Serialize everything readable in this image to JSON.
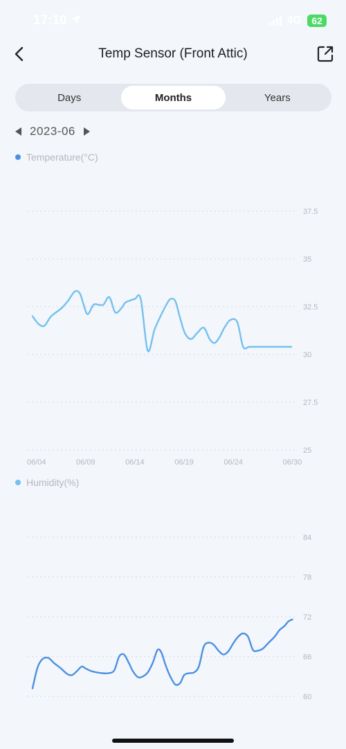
{
  "status_bar": {
    "time": "17:10",
    "network": "4G",
    "battery": "62"
  },
  "header": {
    "title": "Temp Sensor (Front Attic)"
  },
  "tabs": [
    {
      "label": "Days",
      "active": false
    },
    {
      "label": "Months",
      "active": true
    },
    {
      "label": "Years",
      "active": false
    }
  ],
  "date_nav": {
    "period": "2023-06"
  },
  "icons": {
    "back": "chevron-left-icon",
    "share": "share-external-icon",
    "prev": "triangle-left-icon",
    "next": "triangle-right-icon"
  },
  "colors": {
    "temperature": "#74c0ee",
    "humidity": "#4a90e2",
    "temp_legend_dot": "#4a90e2",
    "humidity_legend_dot": "#74c0ee"
  },
  "chart_data": [
    {
      "type": "line",
      "legend": "Temperature(°C)",
      "x_tick_labels": [
        "06/04",
        "06/09",
        "06/14",
        "06/19",
        "06/24",
        "06/30"
      ],
      "x_ticks_day": [
        4,
        9,
        14,
        19,
        24,
        30
      ],
      "ylim": [
        25,
        37.5
      ],
      "yticks": [
        25,
        27.5,
        30,
        32.5,
        35,
        37.5
      ],
      "ytick_labels": [
        "25",
        "27.5",
        "30",
        "32.5",
        "35",
        "37.5"
      ],
      "grid": true,
      "x": [
        3.6,
        4.2,
        4.8,
        5.5,
        6.5,
        7.2,
        7.9,
        8.4,
        8.8,
        9.2,
        9.8,
        10.3,
        10.8,
        11.4,
        12.0,
        12.6,
        13.0,
        13.4,
        14.0,
        14.6,
        15.3,
        16.0,
        16.7,
        17.2,
        17.6,
        18.1,
        18.6,
        19.1,
        19.7,
        20.3,
        21.0,
        21.6,
        22.1,
        22.6,
        23.1,
        23.7,
        24.4,
        25.0,
        25.6,
        26.1,
        26.6,
        27.0,
        27.5,
        28.0,
        28.6,
        29.1,
        29.6,
        29.9
      ],
      "values": [
        32.0,
        31.6,
        31.5,
        32.0,
        32.4,
        32.8,
        33.3,
        33.2,
        32.6,
        32.1,
        32.6,
        32.6,
        32.6,
        33.0,
        32.2,
        32.4,
        32.7,
        32.8,
        32.9,
        32.9,
        30.2,
        31.3,
        32.1,
        32.6,
        32.9,
        32.8,
        31.9,
        31.1,
        30.8,
        31.1,
        31.4,
        30.8,
        30.6,
        30.9,
        31.4,
        31.8,
        31.7,
        30.4,
        30.4,
        30.4,
        30.4,
        30.4,
        30.4,
        30.4,
        30.4,
        30.4,
        30.4,
        30.4
      ]
    },
    {
      "type": "line",
      "legend": "Humidity(%)",
      "ylim": [
        60,
        84
      ],
      "yticks": [
        60,
        66,
        72,
        78,
        84
      ],
      "ytick_labels": [
        "60",
        "66",
        "72",
        "78",
        "84"
      ],
      "grid": true,
      "x": [
        3.6,
        4.1,
        4.6,
        5.2,
        5.8,
        6.5,
        7.1,
        7.6,
        8.1,
        8.6,
        9.0,
        9.6,
        10.2,
        10.7,
        11.3,
        11.9,
        12.4,
        12.9,
        13.4,
        13.8,
        14.3,
        14.8,
        15.3,
        15.8,
        16.3,
        16.7,
        17.1,
        17.6,
        18.1,
        18.6,
        19.0,
        19.5,
        20.0,
        20.5,
        21.0,
        21.5,
        22.0,
        22.5,
        23.0,
        23.5,
        24.0,
        24.5,
        25.0,
        25.5,
        26.0,
        26.5,
        27.0,
        27.6,
        28.2,
        28.7,
        29.2,
        29.6,
        30.0
      ],
      "values": [
        61.2,
        64.3,
        65.6,
        65.8,
        65.0,
        64.2,
        63.4,
        63.2,
        63.8,
        64.5,
        64.2,
        63.8,
        63.6,
        63.5,
        63.5,
        63.9,
        66.0,
        66.3,
        65.0,
        63.8,
        62.9,
        63.0,
        63.6,
        65.0,
        67.0,
        66.6,
        64.8,
        63.0,
        61.8,
        62.0,
        63.2,
        63.5,
        63.6,
        64.5,
        67.5,
        68.1,
        67.8,
        66.9,
        66.3,
        66.8,
        68.0,
        69.0,
        69.5,
        69.0,
        67.0,
        66.9,
        67.2,
        68.1,
        69.0,
        70.0,
        70.6,
        71.3,
        71.6
      ]
    }
  ]
}
